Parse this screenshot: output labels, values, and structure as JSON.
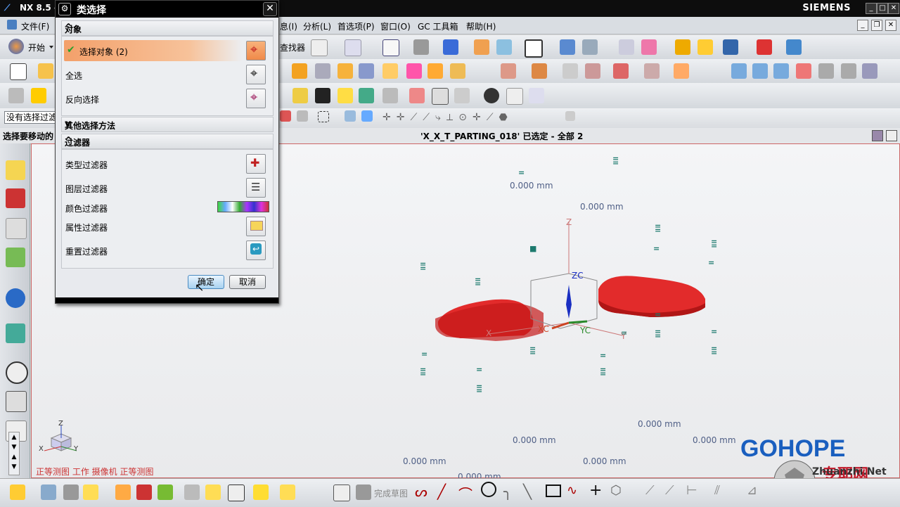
{
  "app": {
    "title": "NX 8.5 - ",
    "brand": "SIEMENS"
  },
  "menubar": {
    "items": [
      "文件(F)",
      "息(I)",
      "分析(L)",
      "首选项(P)",
      "窗口(O)",
      "GC 工具箱",
      "帮助(H)"
    ]
  },
  "toolbar": {
    "start_label": "开始",
    "finder_label": "查找器"
  },
  "selection_bar": {
    "filter_value": "没有选择过滤"
  },
  "cue_line": {
    "prompt": "选择要移动的",
    "status": "'X_X_T_PARTING_018' 已选定 - 全部 2"
  },
  "graphics": {
    "view_label": "正等测图 工作 摄像机 正等测图",
    "dimensions": [
      "0.000 mm",
      "0.000 mm",
      "0.000 mm",
      "0.000 mm",
      "0.000 mm",
      "0.000 mm",
      "0.000 mm",
      "0.000 mm"
    ],
    "axes": {
      "x": "X",
      "y": "Y",
      "z": "Z",
      "xc": "XC",
      "yc": "YC",
      "zc": "ZC"
    },
    "triad": {
      "x": "X",
      "y": "Y",
      "z": "Z"
    },
    "watermark_brand": "GOHOPE",
    "watermark_site": "Zhuanzhi.Net",
    "watermark_cn": "专耶网",
    "accent_color": "#e22b2b"
  },
  "dialog": {
    "title": "类选择",
    "section_object": "对象",
    "select_object": "选择对象 (2)",
    "select_all": "全选",
    "invert_selection": "反向选择",
    "section_other": "其他选择方法",
    "section_filters": "过滤器",
    "type_filter": "类型过滤器",
    "layer_filter": "图层过滤器",
    "color_filter": "颜色过滤器",
    "attribute_filter": "属性过滤器",
    "reset_filter": "重置过滤器",
    "ok": "确定",
    "cancel": "取消"
  },
  "bottombar": {
    "finish_sketch": "完成草图"
  }
}
